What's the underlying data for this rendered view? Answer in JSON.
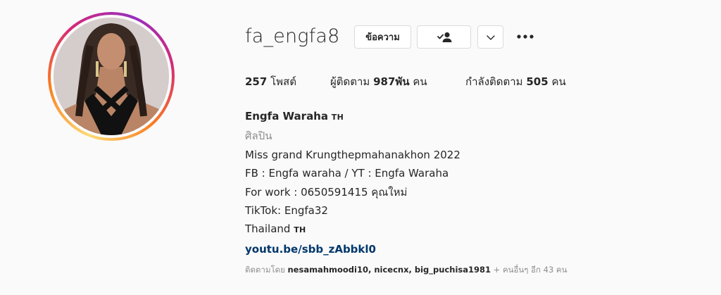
{
  "profile": {
    "username": "fa_engfa8",
    "message_label": "ข้อความ",
    "icons": {
      "following": "person-check-icon",
      "more": "chevron-down-icon",
      "options": "more-horizontal-icon"
    }
  },
  "stats": {
    "posts_count": "257",
    "posts_label": "โพสต์",
    "followers_label": "ผู้ติดตาม",
    "followers_count": "987พัน",
    "followers_unit": "คน",
    "following_label": "กำลังติดตาม",
    "following_count": "505",
    "following_unit": "คน"
  },
  "bio": {
    "full_name": "Engfa Waraha",
    "name_flag": "TH",
    "category": "ศิลปิน",
    "lines": [
      "Miss grand Krungthepmahanakhon 2022",
      "FB : Engfa waraha / YT : Engfa Waraha",
      "For work : 0650591415 คุณใหม่",
      "TikTok: Engfa32"
    ],
    "location": "Thailand",
    "location_flag": "TH",
    "link": "youtu.be/sbb_zAbbkl0"
  },
  "followed_by": {
    "prefix": "ติดตามโดย",
    "names": "nesamahmoodi10, nicecnx, big_puchisa1981",
    "suffix": "+ คนอื่นๆ อีก 43 คน"
  },
  "colors": {
    "background": "#fafafa",
    "text": "#262626",
    "secondary": "#8e8e8e",
    "link": "#00376b",
    "border": "#dbdbdb"
  }
}
